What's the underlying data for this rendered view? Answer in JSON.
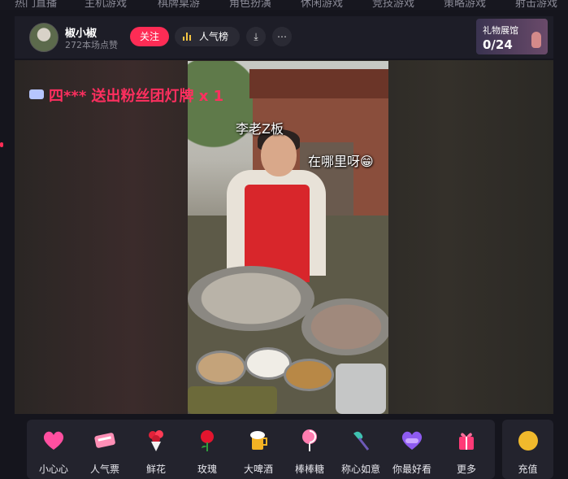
{
  "top_nav": [
    "热门直播",
    "主机游戏",
    "棋牌桌游",
    "角色扮演",
    "休闲游戏",
    "竞技游戏",
    "策略游戏",
    "射击游戏"
  ],
  "header": {
    "name": "椒小椒",
    "likes": "272本场点赞",
    "follow": "关注",
    "rank": "人气榜",
    "gift_hall_title": "礼物展馆",
    "gift_hall_count": "0/24"
  },
  "video": {
    "banner": "四*** 送出粉丝团灯牌 x 1",
    "overlay_1": "李老Z板",
    "overlay_2": "在哪里呀😁"
  },
  "gifts": [
    {
      "label": "小心心",
      "icon": "heart-icon"
    },
    {
      "label": "人气票",
      "icon": "ticket-icon"
    },
    {
      "label": "鲜花",
      "icon": "bouquet-icon"
    },
    {
      "label": "玫瑰",
      "icon": "rose-icon"
    },
    {
      "label": "大啤酒",
      "icon": "beer-icon"
    },
    {
      "label": "棒棒糖",
      "icon": "lollipop-icon"
    },
    {
      "label": "称心如意",
      "icon": "ruyi-icon"
    },
    {
      "label": "你最好看",
      "icon": "heart-badge-icon"
    },
    {
      "label": "更多",
      "icon": "gift-box-icon"
    }
  ],
  "recharge": "充值",
  "colors": {
    "accent": "#fe2c55",
    "banner_text": "#ff2f5f",
    "panel": "#23232d",
    "background": "#15151d"
  }
}
